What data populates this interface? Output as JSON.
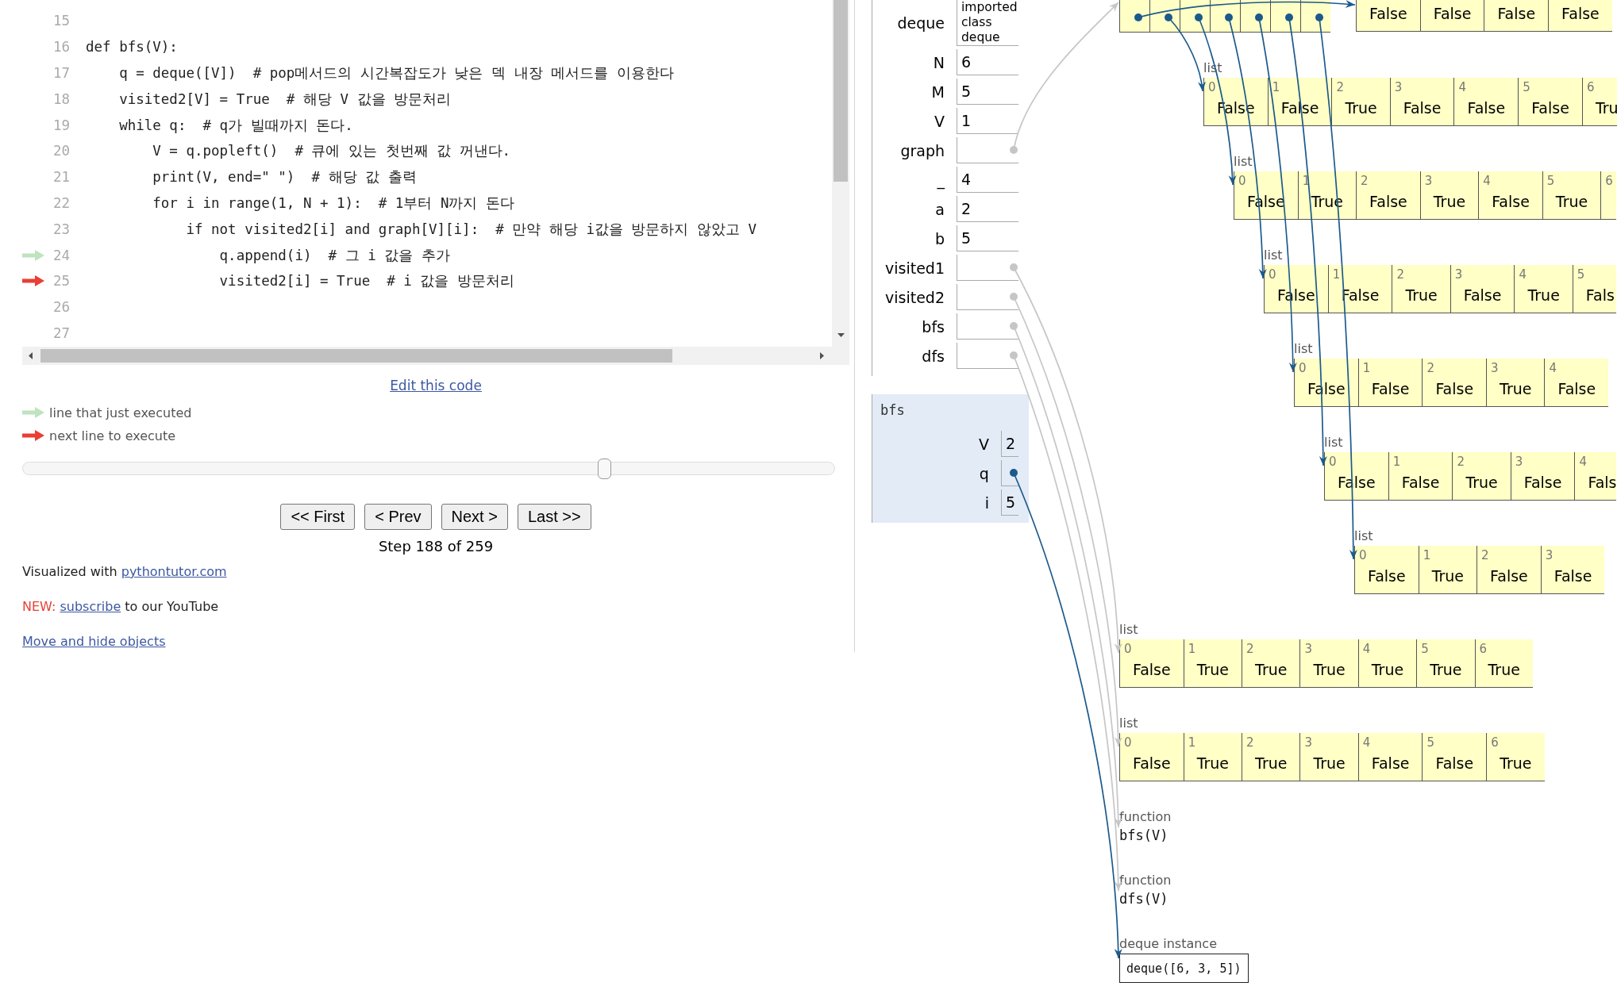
{
  "code_editor": {
    "lines": [
      {
        "number": "15",
        "just_executed": false,
        "next": false
      },
      {
        "number": "16",
        "text": "def bfs(V):",
        "just_executed": false,
        "next": false
      },
      {
        "number": "17",
        "text": "    q = deque([V])  # pop메서드의 시간복잡도가 낮은 덱 내장 메서드를 이용한다",
        "just_executed": false,
        "next": false
      },
      {
        "number": "18",
        "text": "    visited2[V] = True  # 해당 V 값을 방문처리",
        "just_executed": false,
        "next": false
      },
      {
        "number": "19",
        "text": "    while q:  # q가 빌때까지 돈다.",
        "just_executed": false,
        "next": false
      },
      {
        "number": "20",
        "text": "        V = q.popleft()  # 큐에 있는 첫번째 값 꺼낸다.",
        "just_executed": false,
        "next": false
      },
      {
        "number": "21",
        "text": "        print(V, end=\" \")  # 해당 값 출력",
        "just_executed": false,
        "next": false
      },
      {
        "number": "22",
        "text": "        for i in range(1, N + 1):  # 1부터 N까지 돈다",
        "just_executed": false,
        "next": false
      },
      {
        "number": "23",
        "text": "            if not visited2[i] and graph[V][i]:  # 만약 해당 i값을 방문하지 않았고 V",
        "just_executed": false,
        "next": false
      },
      {
        "number": "24",
        "text": "                q.append(i)  # 그 i 값을 추가",
        "just_executed": true,
        "next": false
      },
      {
        "number": "25",
        "text": "                visited2[i] = True  # i 값을 방문처리",
        "just_executed": false,
        "next": true
      },
      {
        "number": "26",
        "just_executed": false,
        "next": false
      },
      {
        "number": "27",
        "just_executed": false,
        "next": false
      }
    ]
  },
  "edit_link": "Edit this code",
  "legend": [
    {
      "kind": "just_executed",
      "label": "line that just executed"
    },
    {
      "kind": "next",
      "label": "next line to execute"
    }
  ],
  "step_slider": {
    "level": 0.72
  },
  "nav_buttons": [
    {
      "label": "<< First"
    },
    {
      "label": "< Prev"
    },
    {
      "label": "Next >"
    },
    {
      "label": "Last >>"
    }
  ],
  "step_label": "Step 188 of 259",
  "credit": {
    "text": "Visualized with",
    "link": "pythontutor.com"
  },
  "news": {
    "tag": "NEW:",
    "link": "subscribe",
    "text": "to our YouTube"
  },
  "move_link": "Move and hide objects",
  "frames": [
    {
      "active": false,
      "variables": [
        {
          "name": "deque",
          "kind": "import",
          "value": "imported class deque"
        },
        {
          "name": "N",
          "kind": "value",
          "value": "6"
        },
        {
          "name": "M",
          "kind": "value",
          "value": "5"
        },
        {
          "name": "V",
          "kind": "value",
          "value": "1"
        },
        {
          "name": "graph",
          "kind": "pointer"
        },
        {
          "name": "_",
          "kind": "value",
          "value": "4"
        },
        {
          "name": "a",
          "kind": "value",
          "value": "2"
        },
        {
          "name": "b",
          "kind": "value",
          "value": "5"
        },
        {
          "name": "visited1",
          "kind": "pointer"
        },
        {
          "name": "visited2",
          "kind": "pointer"
        },
        {
          "name": "bfs",
          "kind": "pointer"
        },
        {
          "name": "dfs",
          "kind": "pointer"
        }
      ]
    },
    {
      "title": "bfs",
      "active": true,
      "variables": [
        {
          "name": "V",
          "kind": "value",
          "value": "2"
        },
        {
          "name": "q",
          "kind": "pointer"
        },
        {
          "name": "i",
          "kind": "value",
          "value": "5"
        }
      ]
    }
  ],
  "heap": [
    {
      "kind": "nested_list",
      "rows": [
        {
          "cells": [
            {
              "value": "False"
            },
            {
              "value": "False"
            },
            {
              "value": "False"
            },
            {
              "value": "False"
            }
          ]
        },
        {
          "label": "list",
          "cells": [
            {
              "index": "0",
              "value": "False"
            },
            {
              "index": "1",
              "value": "False"
            },
            {
              "index": "2",
              "value": "True"
            },
            {
              "index": "3",
              "value": "False"
            },
            {
              "index": "4",
              "value": "False"
            },
            {
              "index": "5",
              "value": "False"
            },
            {
              "index": "6",
              "value": "Tru"
            }
          ]
        },
        {
          "label": "list",
          "cells": [
            {
              "index": "0",
              "value": "False"
            },
            {
              "index": "1",
              "value": "True"
            },
            {
              "index": "2",
              "value": "False"
            },
            {
              "index": "3",
              "value": "True"
            },
            {
              "index": "4",
              "value": "False"
            },
            {
              "index": "5",
              "value": "True"
            },
            {
              "index": "6"
            }
          ]
        },
        {
          "label": "list",
          "cells": [
            {
              "index": "0",
              "value": "False"
            },
            {
              "index": "1",
              "value": "False"
            },
            {
              "index": "2",
              "value": "True"
            },
            {
              "index": "3",
              "value": "False"
            },
            {
              "index": "4",
              "value": "True"
            },
            {
              "index": "5",
              "value": "Fals"
            }
          ]
        },
        {
          "label": "list",
          "cells": [
            {
              "index": "0",
              "value": "False"
            },
            {
              "index": "1",
              "value": "False"
            },
            {
              "index": "2",
              "value": "False"
            },
            {
              "index": "3",
              "value": "True"
            },
            {
              "index": "4",
              "value": "False"
            }
          ]
        },
        {
          "label": "list",
          "cells": [
            {
              "index": "0",
              "value": "False"
            },
            {
              "index": "1",
              "value": "False"
            },
            {
              "index": "2",
              "value": "True"
            },
            {
              "index": "3",
              "value": "False"
            },
            {
              "index": "4",
              "value": "Fals"
            }
          ]
        },
        {
          "label": "list",
          "cells": [
            {
              "index": "0",
              "value": "False"
            },
            {
              "index": "1",
              "value": "True"
            },
            {
              "index": "2",
              "value": "False"
            },
            {
              "index": "3",
              "value": "False"
            }
          ]
        }
      ]
    },
    {
      "kind": "list",
      "label": "list",
      "cells": [
        {
          "index": "0",
          "value": "False"
        },
        {
          "index": "1",
          "value": "True"
        },
        {
          "index": "2",
          "value": "True"
        },
        {
          "index": "3",
          "value": "True"
        },
        {
          "index": "4",
          "value": "True"
        },
        {
          "index": "5",
          "value": "True"
        },
        {
          "index": "6",
          "value": "True"
        }
      ]
    },
    {
      "kind": "list",
      "label": "list",
      "cells": [
        {
          "index": "0",
          "value": "False"
        },
        {
          "index": "1",
          "value": "True"
        },
        {
          "index": "2",
          "value": "True"
        },
        {
          "index": "3",
          "value": "True"
        },
        {
          "index": "4",
          "value": "False"
        },
        {
          "index": "5",
          "value": "False"
        },
        {
          "index": "6",
          "value": "True"
        }
      ]
    },
    {
      "kind": "function",
      "label": "function",
      "signature": "bfs(V)"
    },
    {
      "kind": "function",
      "label": "function",
      "signature": "dfs(V)"
    },
    {
      "kind": "instance",
      "label": "deque instance",
      "value": "deque([6, 3, 5])"
    }
  ]
}
